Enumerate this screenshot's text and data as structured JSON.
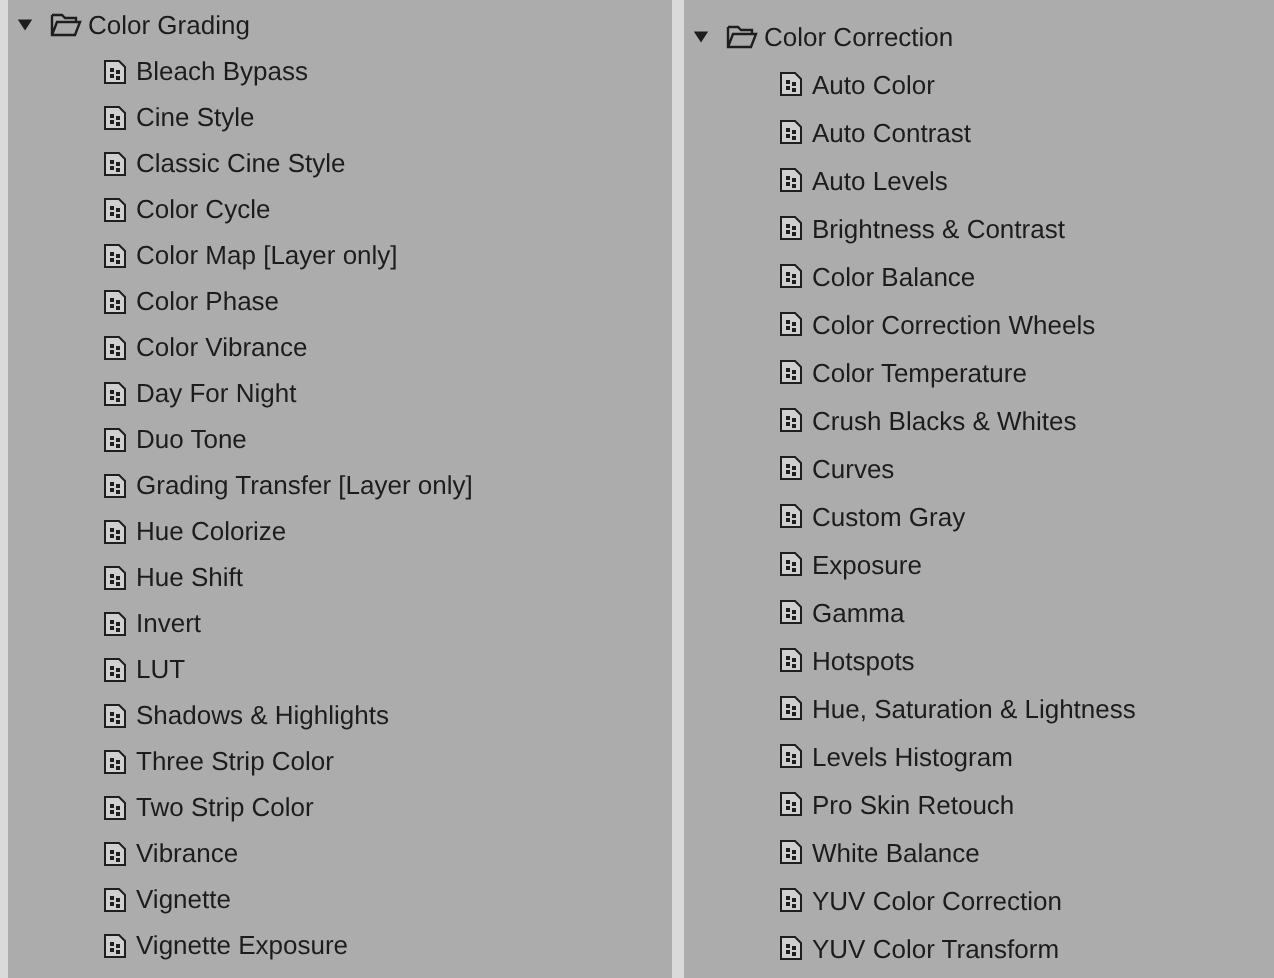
{
  "panels": [
    {
      "label": "Color Grading",
      "expanded": true,
      "children": [
        {
          "label": "Bleach Bypass"
        },
        {
          "label": "Cine Style"
        },
        {
          "label": "Classic Cine Style"
        },
        {
          "label": "Color Cycle"
        },
        {
          "label": "Color Map [Layer only]"
        },
        {
          "label": "Color Phase"
        },
        {
          "label": "Color Vibrance"
        },
        {
          "label": "Day For Night"
        },
        {
          "label": "Duo Tone"
        },
        {
          "label": "Grading Transfer [Layer only]"
        },
        {
          "label": "Hue Colorize"
        },
        {
          "label": "Hue Shift"
        },
        {
          "label": "Invert"
        },
        {
          "label": "LUT"
        },
        {
          "label": "Shadows & Highlights"
        },
        {
          "label": "Three Strip Color"
        },
        {
          "label": "Two Strip Color"
        },
        {
          "label": "Vibrance"
        },
        {
          "label": "Vignette"
        },
        {
          "label": "Vignette Exposure"
        }
      ]
    },
    {
      "label": "Color Correction",
      "expanded": true,
      "children": [
        {
          "label": "Auto Color"
        },
        {
          "label": "Auto Contrast"
        },
        {
          "label": "Auto Levels"
        },
        {
          "label": "Brightness & Contrast"
        },
        {
          "label": "Color Balance"
        },
        {
          "label": "Color Correction Wheels"
        },
        {
          "label": "Color Temperature"
        },
        {
          "label": "Crush Blacks & Whites"
        },
        {
          "label": "Curves"
        },
        {
          "label": "Custom Gray"
        },
        {
          "label": "Exposure"
        },
        {
          "label": "Gamma"
        },
        {
          "label": "Hotspots"
        },
        {
          "label": "Hue, Saturation & Lightness"
        },
        {
          "label": "Levels Histogram"
        },
        {
          "label": "Pro Skin Retouch"
        },
        {
          "label": "White Balance"
        },
        {
          "label": "YUV Color Correction"
        },
        {
          "label": "YUV Color Transform"
        }
      ]
    }
  ]
}
